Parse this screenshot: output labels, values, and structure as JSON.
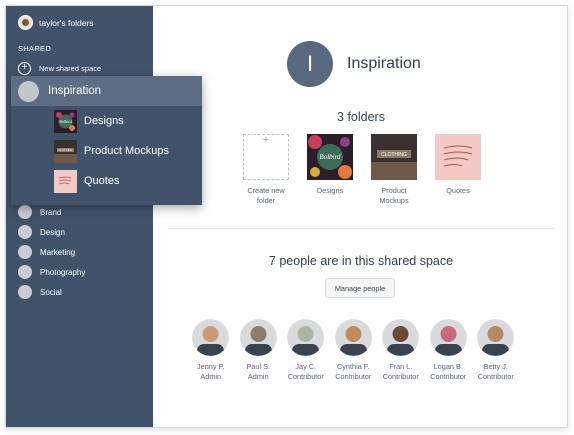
{
  "account": {
    "name": "taylor's folders"
  },
  "sidebar": {
    "section_label": "SHARED",
    "new_space_label": "New shared space",
    "spaces": [
      "Brand",
      "Design",
      "Marketing",
      "Photography",
      "Social"
    ]
  },
  "popup": {
    "title": "Inspiration",
    "items": [
      {
        "label": "Designs",
        "icon": "designs-thumbnail"
      },
      {
        "label": "Product Mockups",
        "icon": "product-mockups-thumbnail"
      },
      {
        "label": "Quotes",
        "icon": "quotes-thumbnail"
      }
    ]
  },
  "main": {
    "avatar_letter": "I",
    "title": "Inspiration",
    "folders_heading": "3 folders",
    "create_folder": [
      "Create new",
      "folder"
    ],
    "folders": [
      {
        "label": [
          "Designs"
        ],
        "icon": "designs-thumbnail"
      },
      {
        "label": [
          "Product",
          "Mockups"
        ],
        "icon": "product-mockups-thumbnail"
      },
      {
        "label": [
          "Quotes"
        ],
        "icon": "quotes-thumbnail"
      }
    ],
    "people_heading": "7 people are in this shared space",
    "manage_button": "Manage people",
    "people": [
      {
        "name": "Jenny P.",
        "role": "Admin",
        "color": "#c99a76"
      },
      {
        "name": "Paul S.",
        "role": "Admin",
        "color": "#8c7d6c"
      },
      {
        "name": "Jay C.",
        "role": "Contributor",
        "color": "#a9b7a4"
      },
      {
        "name": "Cynthia F.",
        "role": "Contributor",
        "color": "#c28a5f"
      },
      {
        "name": "Fran L.",
        "role": "Contributor",
        "color": "#6b4a3a"
      },
      {
        "name": "Logan B.",
        "role": "Contributor",
        "color": "#c96a7a"
      },
      {
        "name": "Betty J.",
        "role": "Contributor",
        "color": "#b58966"
      }
    ]
  }
}
